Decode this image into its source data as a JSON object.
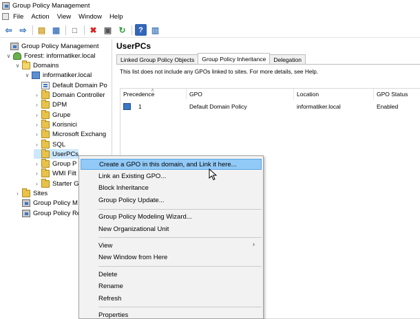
{
  "window": {
    "title": "Group Policy Management"
  },
  "menu": [
    "File",
    "Action",
    "View",
    "Window",
    "Help"
  ],
  "toolbar": [
    {
      "name": "back-icon",
      "glyph": "⇦",
      "color": "#2f6fc0"
    },
    {
      "name": "forward-icon",
      "glyph": "⇨",
      "color": "#2f6fc0"
    },
    {
      "name": "up-folder-icon",
      "glyph": "▤",
      "color": "#c89a1e"
    },
    {
      "name": "show-hide-tree-icon",
      "glyph": "▦",
      "color": "#4a7fc0"
    },
    {
      "name": "copy-icon",
      "glyph": "□",
      "color": "#555555"
    },
    {
      "name": "delete-icon",
      "glyph": "✖",
      "color": "#d42323"
    },
    {
      "name": "properties-icon",
      "glyph": "▣",
      "color": "#555555"
    },
    {
      "name": "refresh-icon",
      "glyph": "↻",
      "color": "#2e9a3a"
    },
    {
      "name": "help-icon",
      "glyph": "?",
      "color": "#ffffff"
    },
    {
      "name": "view-icon",
      "glyph": "▥",
      "color": "#4a7fc0"
    }
  ],
  "tree": [
    {
      "label": "Group Policy Management",
      "icon": "gpm",
      "toggle": "",
      "x": 4
    },
    {
      "label": "Forest: informatiker.local",
      "icon": "forest",
      "toggle": "∨",
      "x": 8
    },
    {
      "label": "Domains",
      "icon": "folder-open",
      "toggle": "∨",
      "x": 21
    },
    {
      "label": "informatiker.local",
      "icon": "domain",
      "toggle": "∨",
      "x": 35
    },
    {
      "label": "Default Domain Po",
      "icon": "gpo",
      "toggle": "",
      "x": 49
    },
    {
      "label": "Domain Controller",
      "icon": "folder",
      "toggle": "›",
      "x": 49
    },
    {
      "label": "DPM",
      "icon": "folder",
      "toggle": "›",
      "x": 49
    },
    {
      "label": "Grupe",
      "icon": "folder",
      "toggle": "›",
      "x": 49
    },
    {
      "label": "Korisnici",
      "icon": "folder",
      "toggle": "›",
      "x": 49
    },
    {
      "label": "Microsoft Exchang",
      "icon": "folder",
      "toggle": "›",
      "x": 49
    },
    {
      "label": "SQL",
      "icon": "folder",
      "toggle": "›",
      "x": 49
    },
    {
      "label": "UserPCs",
      "icon": "folder",
      "toggle": "",
      "x": 49,
      "selected": true
    },
    {
      "label": "Group P",
      "icon": "folder",
      "toggle": "›",
      "x": 49
    },
    {
      "label": "WMI Filt",
      "icon": "folder",
      "toggle": "›",
      "x": 49
    },
    {
      "label": "Starter G",
      "icon": "folder",
      "toggle": "›",
      "x": 49
    },
    {
      "label": "Sites",
      "icon": "folder",
      "toggle": "›",
      "x": 21
    },
    {
      "label": "Group Policy M",
      "icon": "gpm",
      "toggle": "",
      "x": 21
    },
    {
      "label": "Group Policy Re",
      "icon": "gpm",
      "toggle": "",
      "x": 21
    }
  ],
  "right": {
    "title": "UserPCs",
    "tabs": [
      {
        "label": "Linked Group Policy Objects",
        "active": false
      },
      {
        "label": "Group Policy Inheritance",
        "active": true
      },
      {
        "label": "Delegation",
        "active": false
      }
    ],
    "note": "This list does not include any GPOs linked to sites. For more details, see Help.",
    "columns": [
      "Precedence",
      "GPO",
      "Location",
      "GPO Status"
    ],
    "rows": [
      {
        "precedence": "1",
        "gpo": "Default Domain Policy",
        "location": "informatiker.local",
        "status": "Enabled"
      }
    ]
  },
  "context_menu": [
    {
      "label": "Create a GPO in this domain, and Link it here...",
      "highlight": true
    },
    {
      "label": "Link an Existing GPO..."
    },
    {
      "label": "Block Inheritance"
    },
    {
      "label": "Group Policy Update..."
    },
    {
      "sep": true
    },
    {
      "label": "Group Policy Modeling Wizard..."
    },
    {
      "label": "New Organizational Unit"
    },
    {
      "sep": true
    },
    {
      "label": "View",
      "submenu": true
    },
    {
      "label": "New Window from Here"
    },
    {
      "sep": true
    },
    {
      "label": "Delete"
    },
    {
      "label": "Rename"
    },
    {
      "label": "Refresh"
    },
    {
      "sep": true
    },
    {
      "label": "Properties"
    }
  ]
}
